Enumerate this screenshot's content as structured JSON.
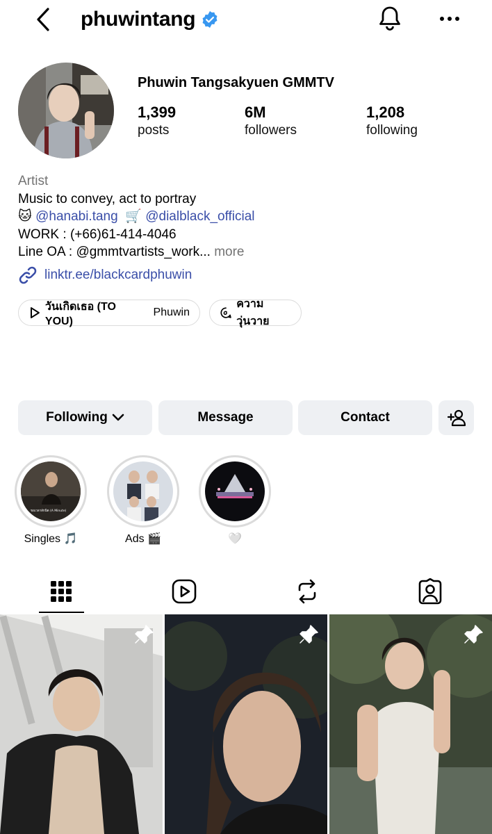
{
  "header": {
    "username": "phuwintang",
    "verified_color": "#3897f0"
  },
  "profile": {
    "display_name": "Phuwin Tangsakyuen GMMTV",
    "stats": [
      {
        "value": "1,399",
        "label": "posts"
      },
      {
        "value": "6M",
        "label": "followers"
      },
      {
        "value": "1,208",
        "label": "following"
      }
    ],
    "bio": {
      "category": "Artist",
      "line1": "Music to convey, act to portray",
      "emoji1": "🐱",
      "mention1": "@hanabi.tang",
      "emoji2": "🛒",
      "mention2": "@dialblack_official",
      "line3": "WORK : (+66)61-414-4046",
      "line4": "Line OA : @gmmtvartists_work...",
      "more": "more"
    },
    "link": "linktr.ee/blackcardphuwin",
    "link_color": "#3a4ea8"
  },
  "chips": {
    "music_song": "วันเกิดเธอ (TO YOU)",
    "music_artist": "Phuwin",
    "threads_label": "ความวุ่นวาย"
  },
  "actions": {
    "following": "Following",
    "message": "Message",
    "contact": "Contact"
  },
  "highlights": [
    {
      "label": "Singles 🎵",
      "cover_text": "ขอเวลาสักนิด (A Minute)"
    },
    {
      "label": "Ads 🎬"
    },
    {
      "label": "🤍"
    }
  ],
  "tabs": [
    "posts-grid",
    "reels",
    "reposts",
    "tagged"
  ]
}
